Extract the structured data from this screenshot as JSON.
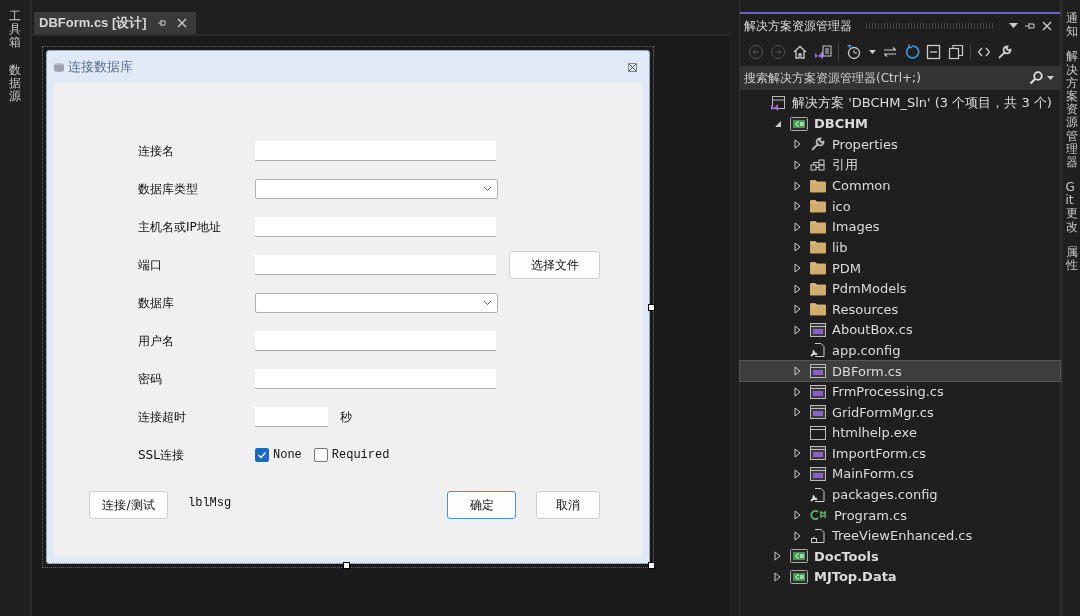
{
  "left_tabs": [
    "工具箱",
    "数据源"
  ],
  "document_tab": {
    "title": "DBForm.cs [设计]",
    "selected": true
  },
  "form": {
    "title": "连接数据库",
    "fields": [
      {
        "kind": "text",
        "label": "连接名"
      },
      {
        "kind": "select",
        "label": "数据库类型"
      },
      {
        "kind": "text",
        "label": "主机名或IP地址"
      },
      {
        "kind": "text",
        "label": "端口",
        "button": "选择文件"
      },
      {
        "kind": "select",
        "label": "数据库"
      },
      {
        "kind": "text",
        "label": "用户名"
      },
      {
        "kind": "text",
        "label": "密码"
      },
      {
        "kind": "short",
        "label": "连接超时",
        "unit": "秒"
      },
      {
        "kind": "checks",
        "label": "SSL连接",
        "options": [
          {
            "label": "None",
            "checked": true
          },
          {
            "label": "Required",
            "checked": false
          }
        ]
      }
    ],
    "footer": {
      "test_button": "连接/测试",
      "message": "lblMsg",
      "ok_button": "确定",
      "cancel_button": "取消"
    }
  },
  "solution_explorer": {
    "title": "解决方案资源管理器",
    "search": {
      "placeholder": "搜索解决方案资源管理器(Ctrl+;)"
    },
    "tree": [
      {
        "kind": "solution",
        "label": "解决方案 'DBCHM_Sln' (3 个项目，共 3 个)",
        "selected": false,
        "children": [
          {
            "kind": "project",
            "label": "DBCHM",
            "expanded": true,
            "selected": false,
            "children": [
              {
                "kind": "properties",
                "label": "Properties",
                "expanded": false,
                "selected": false
              },
              {
                "kind": "references",
                "label": "引用",
                "expanded": false,
                "selected": false
              },
              {
                "kind": "folder",
                "label": "Common",
                "expanded": false,
                "selected": false
              },
              {
                "kind": "folder",
                "label": "ico",
                "expanded": false,
                "selected": false
              },
              {
                "kind": "folder",
                "label": "Images",
                "expanded": false,
                "selected": false
              },
              {
                "kind": "folder",
                "label": "lib",
                "expanded": false,
                "selected": false
              },
              {
                "kind": "folder",
                "label": "PDM",
                "expanded": false,
                "selected": false
              },
              {
                "kind": "folder",
                "label": "PdmModels",
                "expanded": false,
                "selected": false
              },
              {
                "kind": "folder",
                "label": "Resources",
                "expanded": false,
                "selected": false
              },
              {
                "kind": "form",
                "label": "AboutBox.cs",
                "expanded": false,
                "selected": false
              },
              {
                "kind": "config",
                "label": "app.config",
                "selected": false
              },
              {
                "kind": "form",
                "label": "DBForm.cs",
                "expanded": false,
                "selected": true
              },
              {
                "kind": "form",
                "label": "FrmProcessing.cs",
                "expanded": false,
                "selected": false
              },
              {
                "kind": "form",
                "label": "GridFormMgr.cs",
                "expanded": false,
                "selected": false
              },
              {
                "kind": "exe",
                "label": "htmlhelp.exe",
                "selected": false
              },
              {
                "kind": "form",
                "label": "ImportForm.cs",
                "expanded": false,
                "selected": false
              },
              {
                "kind": "form",
                "label": "MainForm.cs",
                "expanded": false,
                "selected": false
              },
              {
                "kind": "config",
                "label": "packages.config",
                "selected": false
              },
              {
                "kind": "csharp",
                "label": "Program.cs",
                "expanded": false,
                "selected": false
              },
              {
                "kind": "code",
                "label": "TreeViewEnhanced.cs",
                "expanded": false,
                "selected": false
              }
            ]
          },
          {
            "kind": "project",
            "label": "DocTools",
            "expanded": false,
            "selected": false
          },
          {
            "kind": "project",
            "label": "MJTop.Data",
            "expanded": false,
            "selected": false
          }
        ]
      }
    ]
  },
  "right_tabs": [
    "通知",
    "解决方案资源管理器",
    "Git 更改",
    "属性"
  ]
}
